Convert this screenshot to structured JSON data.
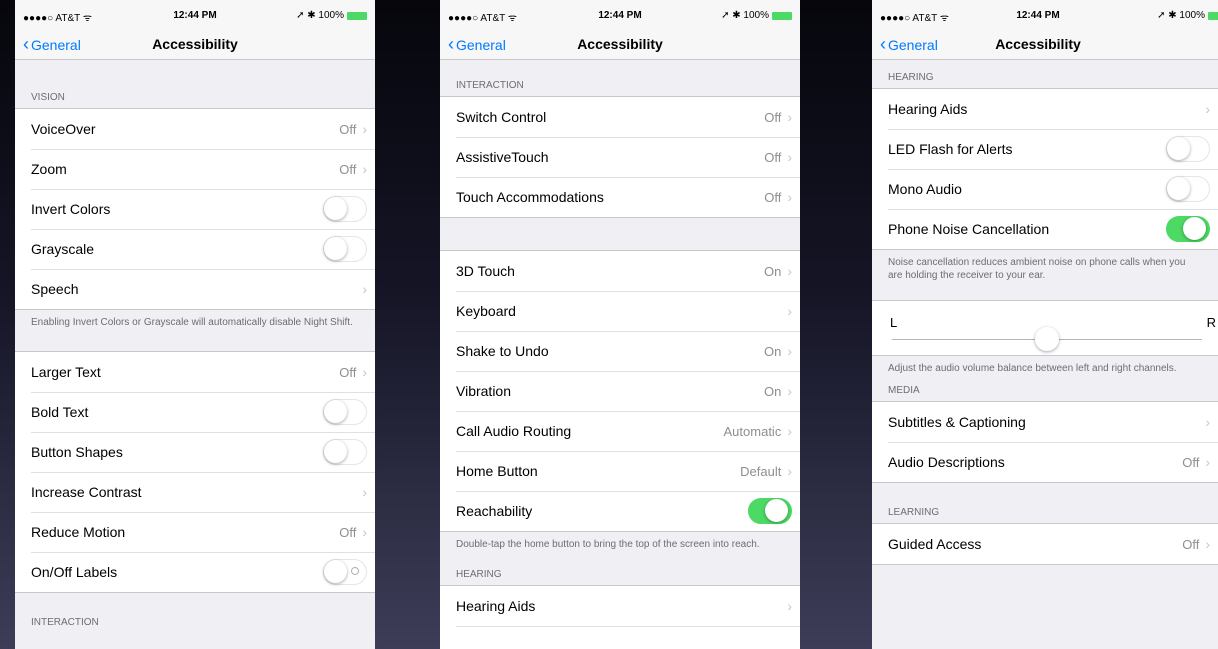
{
  "status": {
    "carrier": "●●●●○ AT&T ᯤ",
    "time": "12:44 PM",
    "battery": "➚ ✱ 100%"
  },
  "nav": {
    "back": "General",
    "title": "Accessibility"
  },
  "p1": {
    "vision_header": "VISION",
    "vision": [
      {
        "label": "VoiceOver",
        "value": "Off"
      },
      {
        "label": "Zoom",
        "value": "Off"
      },
      {
        "label": "Invert Colors",
        "toggle": "off"
      },
      {
        "label": "Grayscale",
        "toggle": "off"
      },
      {
        "label": "Speech"
      }
    ],
    "vision_footer": "Enabling Invert Colors or Grayscale will automatically disable Night Shift.",
    "text": [
      {
        "label": "Larger Text",
        "value": "Off"
      },
      {
        "label": "Bold Text",
        "toggle": "off"
      },
      {
        "label": "Button Shapes",
        "toggle": "off"
      },
      {
        "label": "Increase Contrast"
      },
      {
        "label": "Reduce Motion",
        "value": "Off"
      },
      {
        "label": "On/Off Labels",
        "toggle": "off"
      }
    ],
    "interaction_header": "INTERACTION"
  },
  "p2": {
    "interaction_header": "INTERACTION",
    "interaction": [
      {
        "label": "Switch Control",
        "value": "Off"
      },
      {
        "label": "AssistiveTouch",
        "value": "Off"
      },
      {
        "label": "Touch Accommodations",
        "value": "Off"
      }
    ],
    "more": [
      {
        "label": "3D Touch",
        "value": "On"
      },
      {
        "label": "Keyboard"
      },
      {
        "label": "Shake to Undo",
        "value": "On"
      },
      {
        "label": "Vibration",
        "value": "On"
      },
      {
        "label": "Call Audio Routing",
        "value": "Automatic"
      },
      {
        "label": "Home Button",
        "value": "Default"
      },
      {
        "label": "Reachability",
        "toggle": "on"
      }
    ],
    "reach_footer": "Double-tap the home button to bring the top of the screen into reach.",
    "hearing_header": "HEARING",
    "hearing": [
      {
        "label": "Hearing Aids"
      }
    ]
  },
  "p3": {
    "hearing_header": "HEARING",
    "hearing": [
      {
        "label": "Hearing Aids"
      },
      {
        "label": "LED Flash for Alerts",
        "toggle": "off"
      },
      {
        "label": "Mono Audio",
        "toggle": "off"
      },
      {
        "label": "Phone Noise Cancellation",
        "toggle": "on"
      }
    ],
    "noise_footer": "Noise cancellation reduces ambient noise on phone calls when you are holding the receiver to your ear.",
    "balance": {
      "left": "L",
      "right": "R",
      "value": 0.5
    },
    "balance_footer": "Adjust the audio volume balance between left and right channels.",
    "media_header": "MEDIA",
    "media": [
      {
        "label": "Subtitles & Captioning"
      },
      {
        "label": "Audio Descriptions",
        "value": "Off"
      }
    ],
    "learning_header": "LEARNING",
    "learning": [
      {
        "label": "Guided Access",
        "value": "Off"
      }
    ]
  }
}
